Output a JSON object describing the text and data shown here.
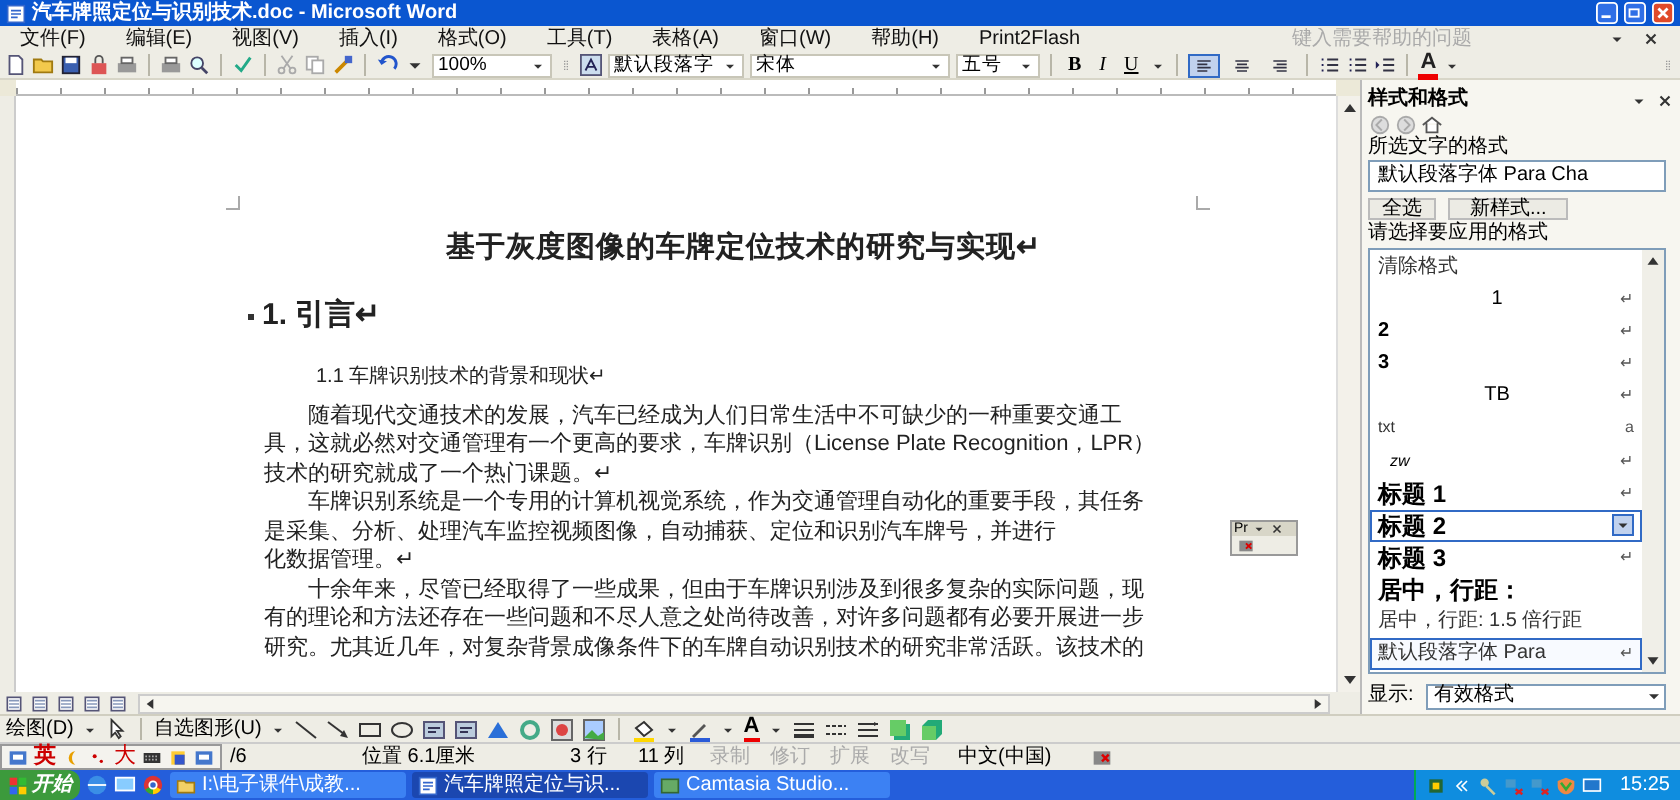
{
  "window": {
    "title": "汽车牌照定位与识别技术.doc - Microsoft Word"
  },
  "menu": [
    "文件(F)",
    "编辑(E)",
    "视图(V)",
    "插入(I)",
    "格式(O)",
    "工具(T)",
    "表格(A)",
    "窗口(W)",
    "帮助(H)",
    "Print2Flash"
  ],
  "help_box": {
    "placeholder": "键入需要帮助的问题"
  },
  "toolbar": {
    "zoom": "100%",
    "style": "默认段落字",
    "font": "宋体",
    "size": "五号",
    "bold": "B",
    "italic": "I",
    "underline": "U",
    "font_color": "A",
    "align": [
      {
        "selected": true
      },
      {
        "selected": false
      },
      {
        "selected": false
      }
    ]
  },
  "document": {
    "title": "基于灰度图像的车牌定位技术的研究与实现↵",
    "heading": "1.  引言↵",
    "subheading": "1.1  车牌识别技术的背景和现状↵",
    "paragraphs": [
      {
        "lines": [
          "随着现代交通技术的发展，汽车已经成为人们日常生活中不可缺少的一种重要交通工",
          "具，这就必然对交通管理有一个更高的要求，车牌识别（License Plate Recognition，LPR）",
          "技术的研究就成了一个热门课题。↵"
        ]
      },
      {
        "lines": [
          "车牌识别系统是一个专用的计算机视觉系统，作为交通管理自动化的重要手段，其任务",
          "是采集、分析、处理汽车监控视频图像，自动捕获、定位和识别汽车牌号，并进行",
          "化数据管理。↵"
        ]
      },
      {
        "lines": [
          "十余年来，尽管已经取得了一些成果，但由于车牌识别涉及到很多复杂的实际问题，现",
          "有的理论和方法还存在一些问题和不尽人意之处尚待改善，对许多问题都有必要开展进一步",
          "研究。尤其近几年，对复杂背景成像条件下的车牌自动识别技术的研究非常活跃。该技术的"
        ]
      }
    ]
  },
  "float_toolbar": {
    "label": "Pr"
  },
  "task_pane": {
    "title": "样式和格式",
    "selection_label": "所选文字的格式",
    "selection_value": "默认段落字体 Para Cha",
    "buttons": [
      "全选",
      "新样式..."
    ],
    "list_label": "请选择要应用的格式",
    "styles": [
      {
        "label": "清除格式",
        "kind": "clear",
        "selected": false,
        "current": false
      },
      {
        "label": "1",
        "mark": "↵",
        "kind": "centered",
        "selected": false,
        "current": false
      },
      {
        "label": "2",
        "mark": "↵",
        "kind": "bold",
        "selected": false,
        "current": false
      },
      {
        "label": "3",
        "mark": "↵",
        "kind": "bold",
        "selected": false,
        "current": false
      },
      {
        "label": "TB",
        "mark": "↵",
        "kind": "centered",
        "selected": false,
        "current": false
      },
      {
        "label": "txt",
        "mark": "a",
        "kind": "small",
        "selected": false,
        "current": false
      },
      {
        "label": "zw",
        "mark": "↵",
        "kind": "italic",
        "selected": false,
        "current": false
      },
      {
        "label": "标题 1",
        "mark": "↵",
        "kind": "heading",
        "selected": false,
        "current": false
      },
      {
        "label": "标题 2",
        "kind": "heading",
        "selected": true,
        "current": false
      },
      {
        "label": "标题 3",
        "mark": "↵",
        "kind": "heading",
        "selected": false,
        "current": false
      },
      {
        "label": "居中，行距：",
        "kind": "heading",
        "selected": false,
        "current": false
      },
      {
        "label": "居中，行距: 1.5 倍行距",
        "kind": "plain",
        "selected": false,
        "current": false
      },
      {
        "label": "默认段落字体 Para",
        "mark": "↵",
        "kind": "plain",
        "selected": false,
        "current": true
      }
    ],
    "show_label": "显示:",
    "show_value": "有效格式"
  },
  "drawing_toolbar": {
    "draw": "绘图(D)",
    "autoshapes": "自选图形(U)",
    "font_color": "A"
  },
  "ime": {
    "mode": "英",
    "width": "大"
  },
  "status_bar": {
    "page": "/6",
    "position": "位置 6.1厘米",
    "line": "3 行",
    "column": "11 列",
    "modes": [
      {
        "label": "录制",
        "on": false
      },
      {
        "label": "修订",
        "on": false
      },
      {
        "label": "扩展",
        "on": false
      },
      {
        "label": "改写",
        "on": false
      }
    ],
    "language": "中文(中国)"
  },
  "taskbar": {
    "start": "开始",
    "tasks": [
      {
        "label": "I:\\电子课件\\成教...",
        "selected": false
      },
      {
        "label": "汽车牌照定位与识...",
        "selected": true
      },
      {
        "label": "Camtasia Studio...",
        "selected": false
      }
    ],
    "clock": "15:25"
  }
}
